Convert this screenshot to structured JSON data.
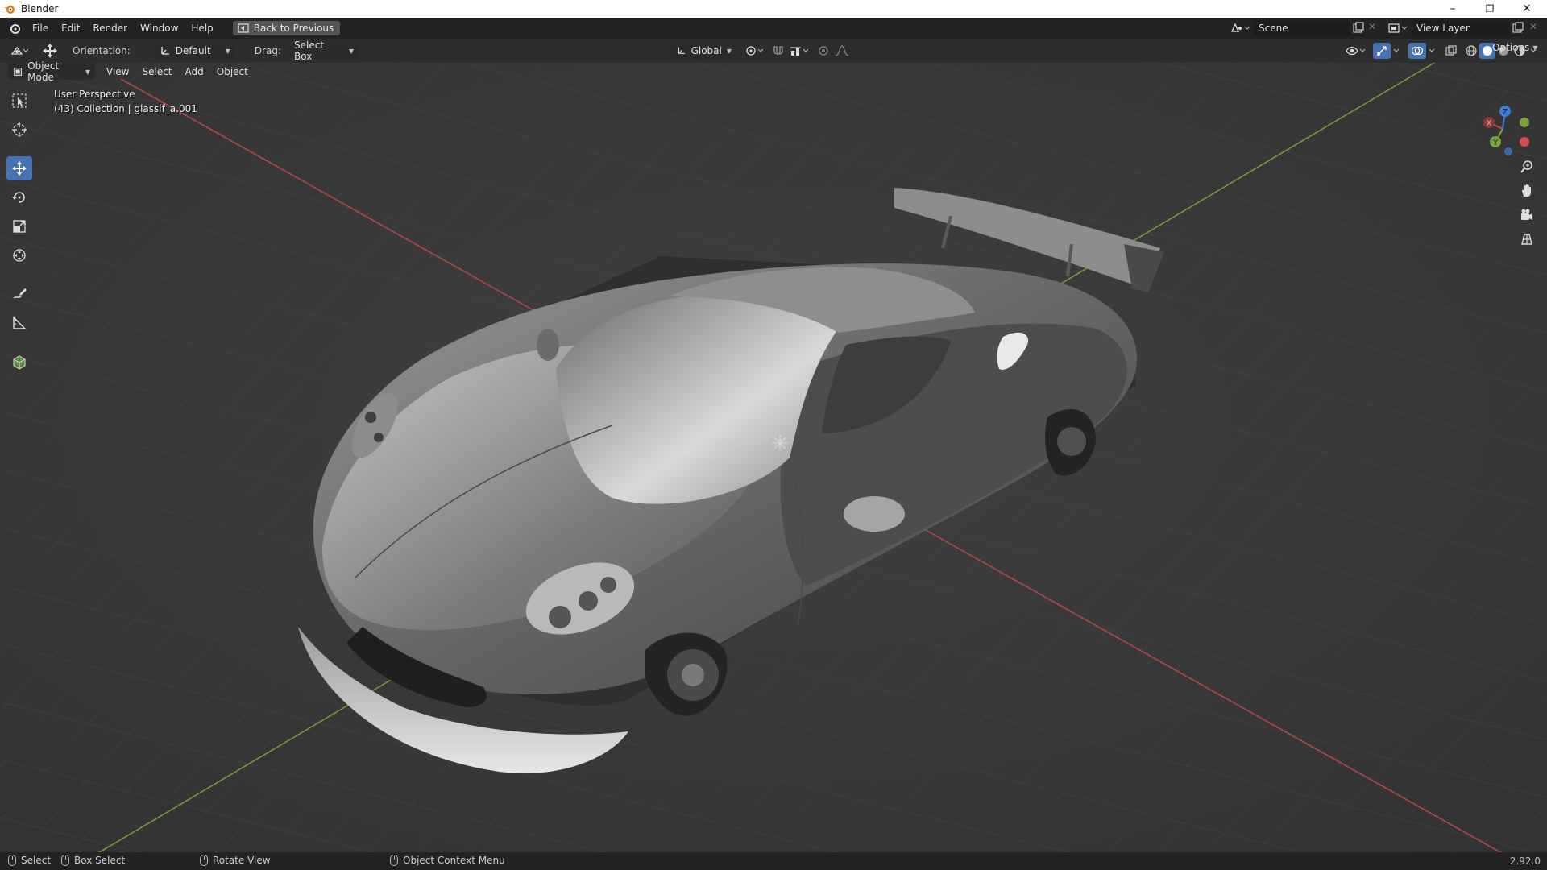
{
  "window": {
    "title": "Blender",
    "controls": {
      "minimize": "–",
      "maximize": "❐",
      "close": "✕"
    }
  },
  "topbar": {
    "menus": [
      "File",
      "Edit",
      "Render",
      "Window",
      "Help"
    ],
    "back_button": "Back to Previous",
    "scene_name": "Scene",
    "view_layer": "View Layer"
  },
  "header": {
    "orientation_label": "Orientation:",
    "orientation_value": "Default",
    "drag_label": "Drag:",
    "drag_value": "Select Box",
    "transform_orientation": "Global",
    "options": "Options"
  },
  "subheader": {
    "mode": "Object Mode",
    "menus": [
      "View",
      "Select",
      "Add",
      "Object"
    ]
  },
  "viewport": {
    "view_name": "User Perspective",
    "collection_info": "(43) Collection | glasslf_a.001",
    "gizmo": {
      "x": "X",
      "y": "Y",
      "z": "Z"
    }
  },
  "toolbar": {
    "tools": [
      "select-box-tool",
      "cursor-tool",
      "move-tool",
      "rotate-tool",
      "scale-tool",
      "transform-tool",
      "annotate-tool",
      "measure-tool",
      "add-cube-tool"
    ],
    "active_tool": "move-tool"
  },
  "statusbar": {
    "items": [
      "Select",
      "Box Select",
      "Rotate View",
      "Object Context Menu"
    ],
    "version": "2.92.0"
  },
  "colors": {
    "accent": "#4772b3",
    "x_axis": "#c84848",
    "y_axis": "#7aa339",
    "z_axis": "#3f7fd6"
  }
}
